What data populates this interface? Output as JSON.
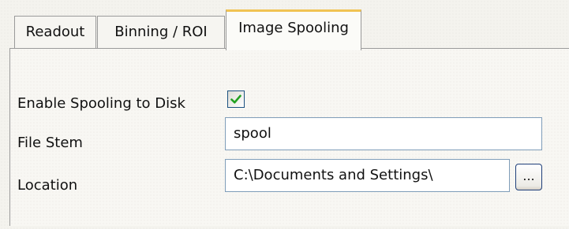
{
  "tabs": [
    {
      "label": "Readout"
    },
    {
      "label": "Binning / ROI"
    },
    {
      "label": "Image Spooling",
      "active": true
    }
  ],
  "form": {
    "enable_spooling": {
      "label": "Enable Spooling to Disk",
      "checked": true
    },
    "file_stem": {
      "label": "File Stem",
      "value": "spool"
    },
    "location": {
      "label": "Location",
      "value": "C:\\Documents and Settings\\",
      "browse_label": "..."
    }
  },
  "icons": {
    "checkbox_mark": "checkmark-icon"
  },
  "colors": {
    "active_tab_accent": "#f0c353",
    "checkbox_border": "#1c5180",
    "checkmark": "#21a121",
    "input_border": "#7f9db9"
  }
}
